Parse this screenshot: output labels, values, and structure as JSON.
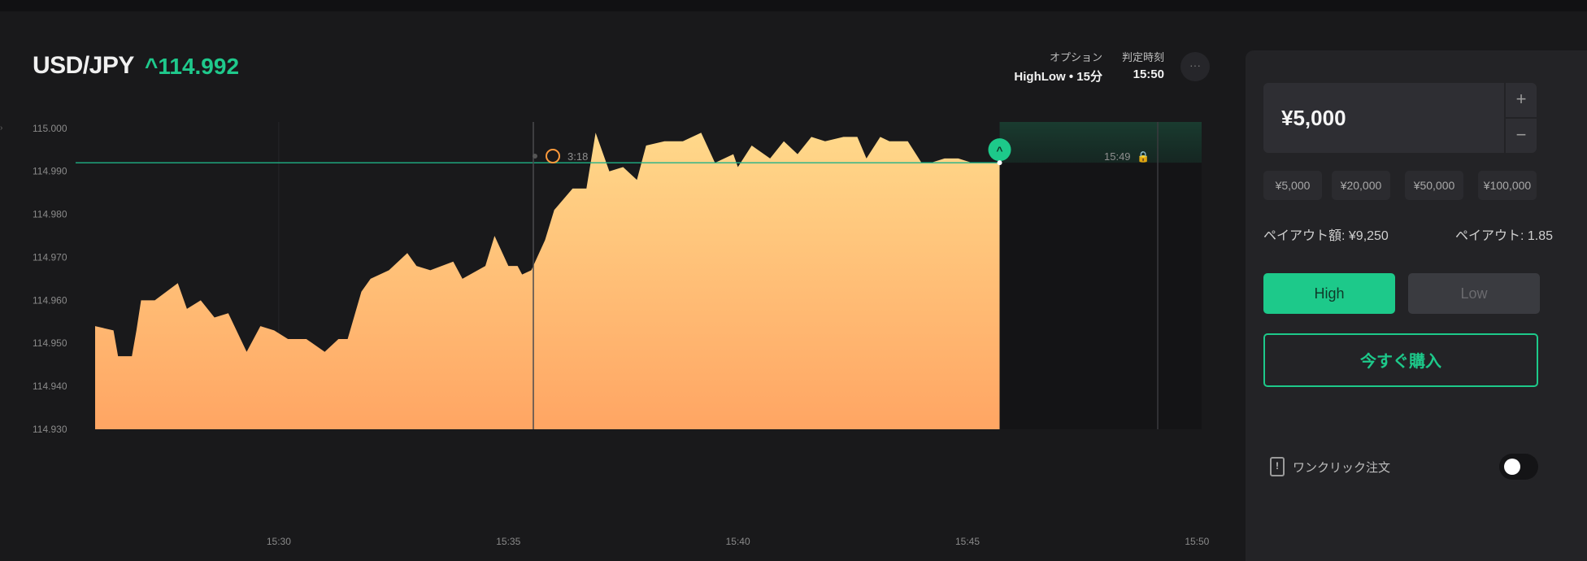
{
  "header": {
    "pair": "USD/JPY",
    "price_change": "^114.992",
    "option_label": "オプション",
    "option_value": "HighLow • 15分",
    "expiry_label": "判定時刻",
    "expiry_value": "15:50",
    "more_label": "···"
  },
  "chart_data": {
    "type": "area",
    "y_ticks": [
      "115.000",
      "114.990",
      "114.980",
      "114.970",
      "114.960",
      "114.950",
      "114.940",
      "114.930"
    ],
    "ylim": [
      114.93,
      115.003
    ],
    "x_ticks": [
      "15:30",
      "15:35",
      "15:40",
      "15:45",
      "15:50"
    ],
    "x_tick_minutes": [
      30,
      35,
      40,
      45,
      50
    ],
    "xlim_minutes": [
      26.0,
      50.1
    ],
    "current_value": 114.992,
    "timer_label": "3:18",
    "close_label": "15:49",
    "series": [
      {
        "x": [
          26.0,
          26.4,
          26.5,
          26.8,
          26.9,
          27.0,
          27.3,
          27.8,
          28.0,
          28.3,
          28.6,
          28.9,
          29.3,
          29.6,
          29.9,
          30.2,
          30.6,
          31.0,
          31.3,
          31.5,
          31.8,
          32.0,
          32.4,
          32.8,
          33.0,
          33.3,
          33.8,
          34.0,
          34.5,
          34.7,
          35.0,
          35.2,
          35.3,
          35.5,
          35.8,
          36.0,
          36.4,
          36.7,
          36.9,
          37.2,
          37.5,
          37.7,
          37.8,
          38.0,
          38.4,
          38.8,
          39.2,
          39.5,
          39.9,
          40.0,
          40.3,
          40.7,
          41.0,
          41.3,
          41.6,
          41.9,
          42.3,
          42.6,
          42.8,
          43.1,
          43.3,
          43.7,
          44.0,
          44.2,
          44.5,
          44.8,
          45.1,
          45.4,
          45.5,
          45.7
        ],
        "y": [
          114.954,
          114.953,
          114.947,
          114.947,
          114.953,
          114.96,
          114.96,
          114.964,
          114.958,
          114.96,
          114.956,
          114.957,
          114.948,
          114.954,
          114.953,
          114.951,
          114.951,
          114.948,
          114.951,
          114.951,
          114.962,
          114.965,
          114.967,
          114.971,
          114.968,
          114.967,
          114.969,
          114.965,
          114.968,
          114.975,
          114.968,
          114.968,
          114.966,
          114.967,
          114.974,
          114.981,
          114.986,
          114.986,
          114.999,
          114.99,
          114.991,
          114.989,
          114.988,
          114.996,
          114.997,
          114.997,
          114.999,
          114.992,
          114.994,
          114.991,
          114.996,
          114.993,
          114.997,
          114.994,
          114.998,
          114.997,
          114.998,
          114.998,
          114.993,
          114.998,
          114.997,
          114.997,
          114.992,
          114.992,
          114.993,
          114.993,
          114.992,
          114.992,
          114.992,
          114.992
        ]
      }
    ]
  },
  "panel": {
    "amount": "¥5,000",
    "plus": "+",
    "minus": "−",
    "chips": [
      "¥5,000",
      "¥20,000",
      "¥50,000",
      "¥100,000"
    ],
    "payout_amount": "ペイアウト額: ¥9,250",
    "payout_rate": "ペイアウト: 1.85",
    "high_label": "High",
    "low_label": "Low",
    "buy_label": "今すぐ購入",
    "oneclick_icon_glyph": "!",
    "oneclick_label": "ワンクリック注文"
  },
  "colors": {
    "accent": "#1dc98a",
    "area_top": "#ffd484",
    "area_bottom": "#ffa866",
    "background": "#19191b"
  }
}
